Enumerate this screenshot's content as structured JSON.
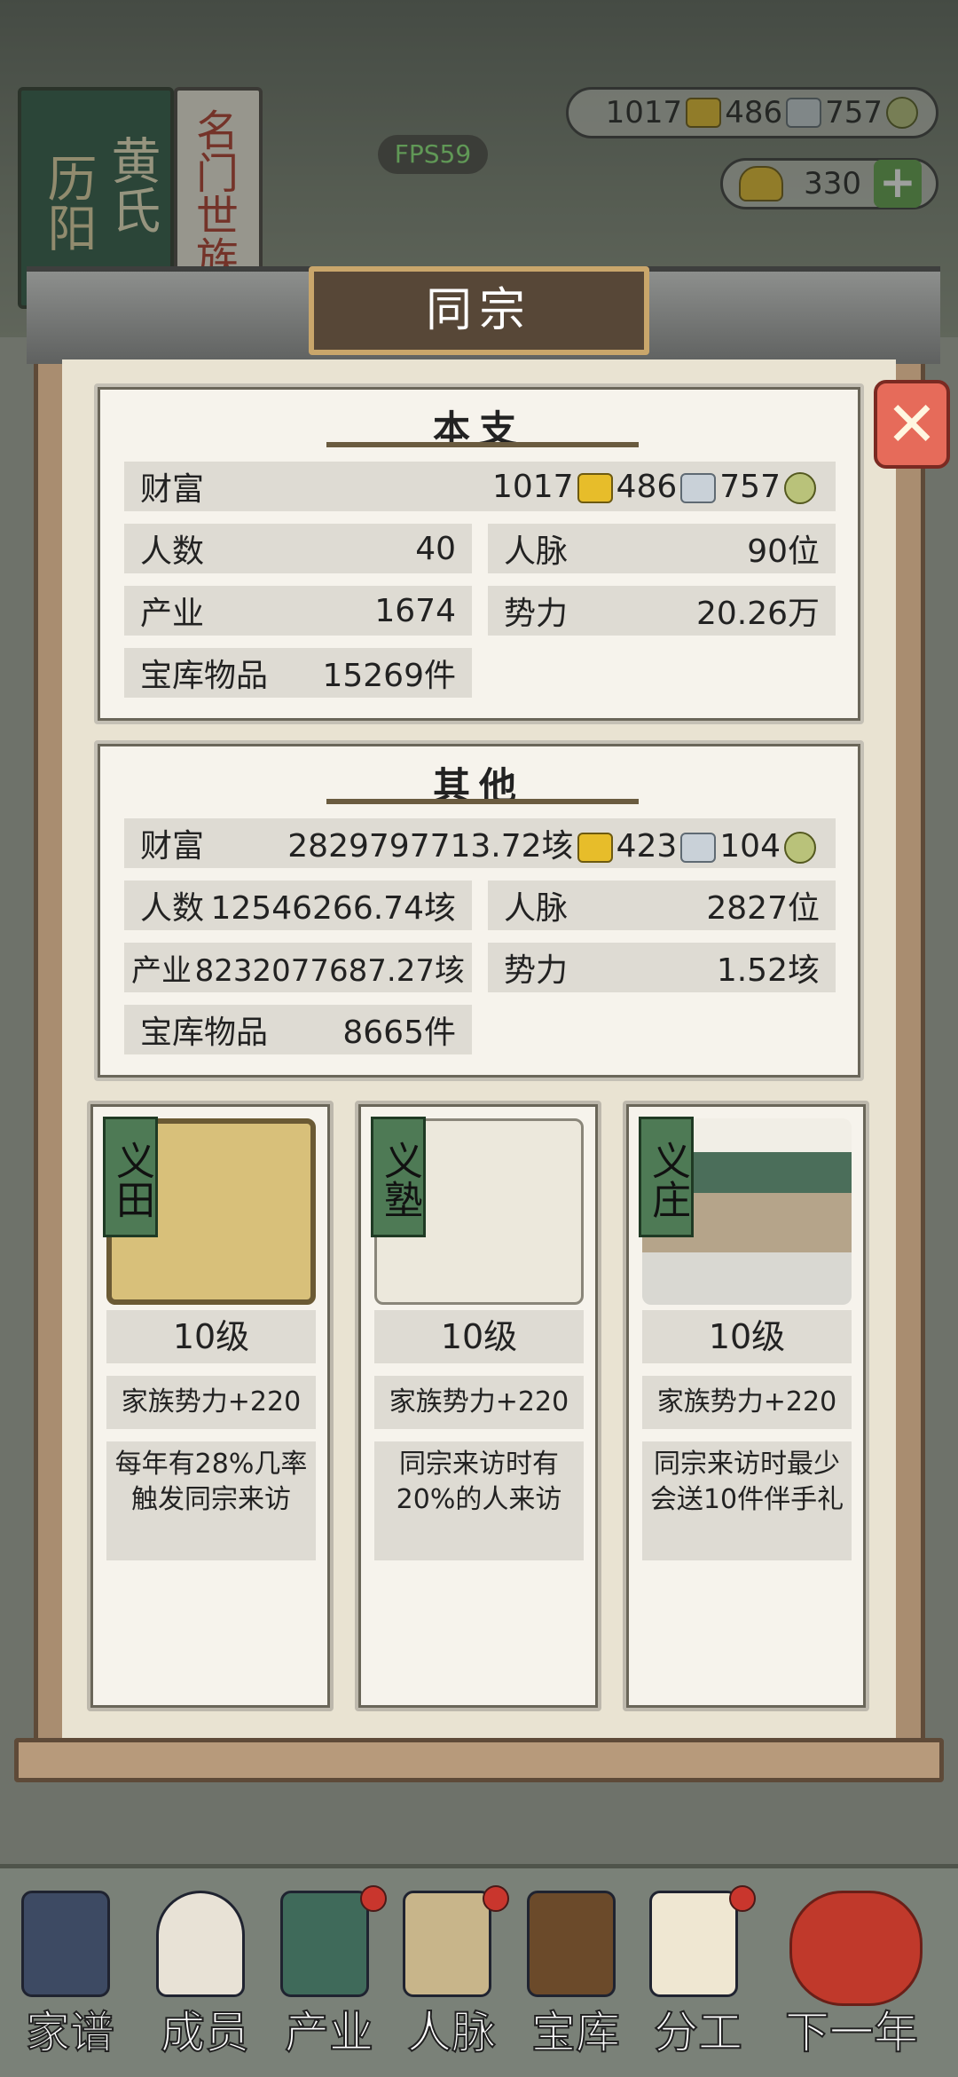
{
  "fps": "FPS59",
  "resources": {
    "gold": "1017",
    "silver": "486",
    "copper": "757",
    "ingots": "330",
    "plus": "+"
  },
  "background": {
    "green_book": [
      "历阳",
      "黄氏"
    ],
    "red_book": "名门世族"
  },
  "modal": {
    "title": "同宗",
    "close_label": "✕",
    "main_branch": {
      "title": "本支",
      "wealth_label": "财富",
      "wealth_gold": "1017",
      "wealth_silver": "486",
      "wealth_copper": "757",
      "people_label": "人数",
      "people_value": "40",
      "connections_label": "人脉",
      "connections_value": "90位",
      "industry_label": "产业",
      "industry_value": "1674",
      "power_label": "势力",
      "power_value": "20.26万",
      "vault_label": "宝库物品",
      "vault_value": "15269件"
    },
    "others": {
      "title": "其他",
      "wealth_label": "财富",
      "wealth_gold": "2829797713.72垓",
      "wealth_silver": "423",
      "wealth_copper": "104",
      "people_label": "人数",
      "people_value": "12546266.74垓",
      "connections_label": "人脉",
      "connections_value": "2827位",
      "industry_label": "产业",
      "industry_value": "8232077687.27垓",
      "power_label": "势力",
      "power_value": "1.52垓",
      "vault_label": "宝库物品",
      "vault_value": "8665件"
    },
    "cards": [
      {
        "tag": "义田",
        "level": "10级",
        "bonus": "家族势力+220",
        "desc": "每年有28%几率触发同宗来访"
      },
      {
        "tag": "义塾",
        "level": "10级",
        "bonus": "家族势力+220",
        "desc": "同宗来访时有20%的人来访"
      },
      {
        "tag": "义庄",
        "level": "10级",
        "bonus": "家族势力+220",
        "desc": "同宗来访时最少会送10件伴手礼"
      }
    ]
  },
  "nav": [
    {
      "label": "家谱",
      "icon": "genealogy-book-icon"
    },
    {
      "label": "成员",
      "icon": "member-icon"
    },
    {
      "label": "产业",
      "icon": "building-icon"
    },
    {
      "label": "人脉",
      "icon": "network-icon"
    },
    {
      "label": "宝库",
      "icon": "treasure-chest-icon"
    },
    {
      "label": "分工",
      "icon": "scroll-icon"
    },
    {
      "label": "下一年",
      "icon": "lantern-icon"
    }
  ],
  "colors": {
    "panel_bg": "#f6f3ec",
    "row_bg": "#dedbd3",
    "title_plate": "#574737",
    "close_red": "#e66b5a",
    "card_tag_green": "#4e7a55"
  }
}
